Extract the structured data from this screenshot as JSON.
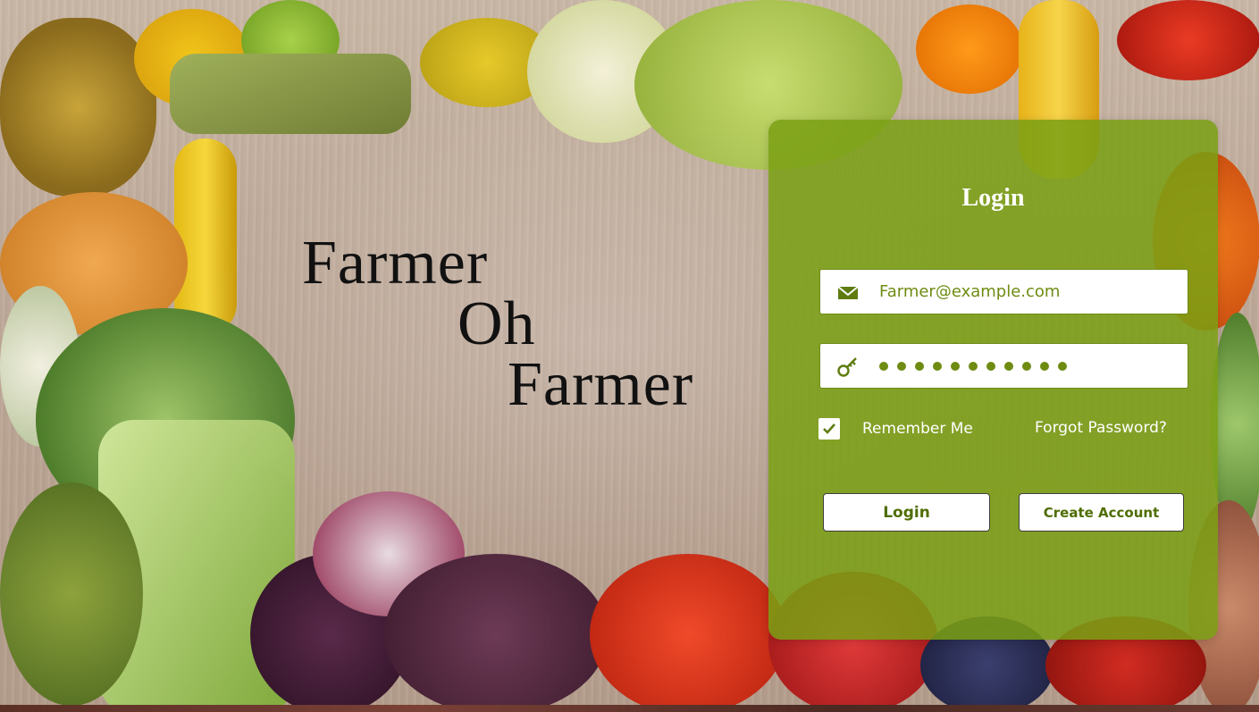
{
  "brand": {
    "line1": "Farmer",
    "line2": "Oh",
    "line3": "Farmer"
  },
  "login_panel": {
    "title": "Login",
    "email": {
      "value": "Farmer@example.com",
      "icon": "envelope-icon"
    },
    "password": {
      "masked_length": 11,
      "icon": "key-icon"
    },
    "remember_me": {
      "label": "Remember Me",
      "checked": true
    },
    "forgot_password_label": "Forgot Password?",
    "login_button_label": "Login",
    "create_account_button_label": "Create Account"
  },
  "colors": {
    "panel": "#7aa014",
    "accent_text": "#6e8c12",
    "button_text": "#4f6d00"
  }
}
